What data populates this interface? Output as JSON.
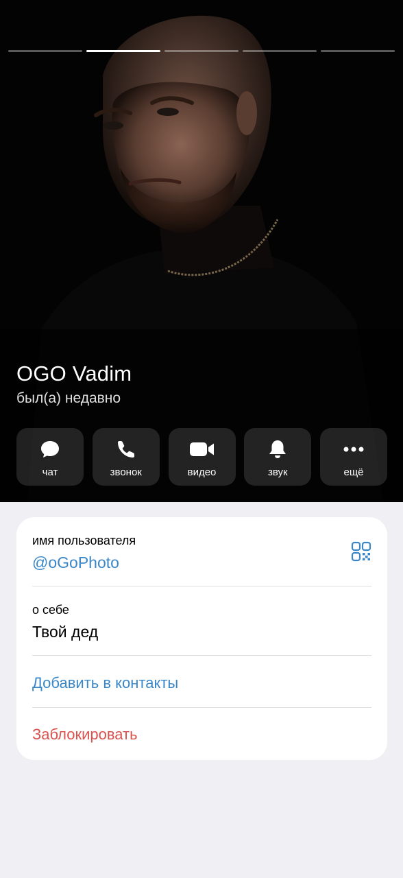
{
  "profile": {
    "name": "OGO Vadim",
    "status": "был(а) недавно"
  },
  "story": {
    "segments": 5,
    "active_index": 1
  },
  "actions": [
    {
      "label": "чат",
      "icon": "chat-bubble-icon"
    },
    {
      "label": "звонок",
      "icon": "phone-icon"
    },
    {
      "label": "видео",
      "icon": "video-camera-icon"
    },
    {
      "label": "звук",
      "icon": "bell-icon"
    },
    {
      "label": "ещё",
      "icon": "more-dots-icon"
    }
  ],
  "info": {
    "username_caption": "имя пользователя",
    "username_value": "@oGoPhoto",
    "bio_caption": "о себе",
    "bio_value": "Твой дед",
    "add_contact": "Добавить в контакты",
    "block": "Заблокировать"
  },
  "colors": {
    "link": "#3a87c8",
    "danger": "#d8534e",
    "background": "#efeff4"
  }
}
